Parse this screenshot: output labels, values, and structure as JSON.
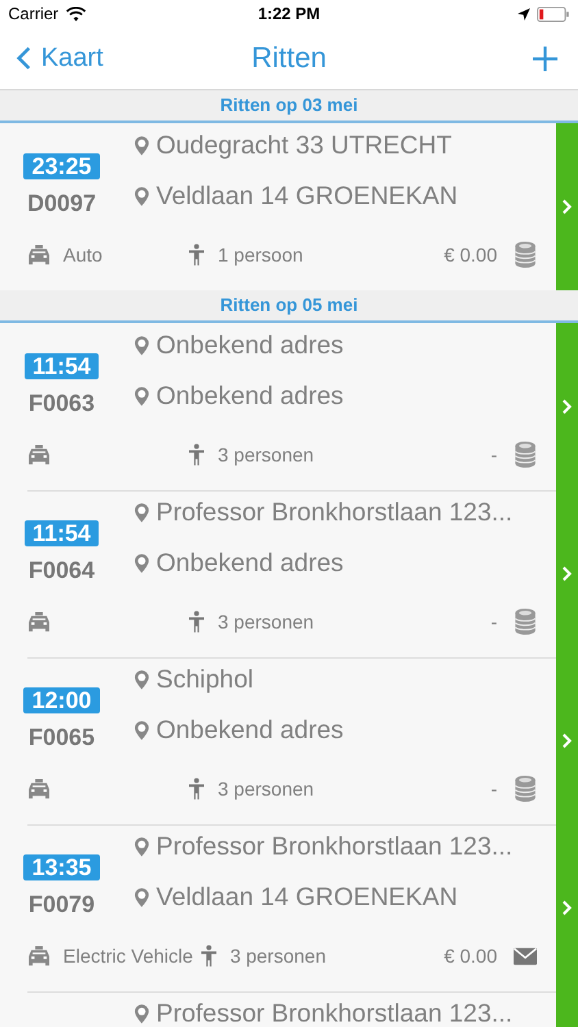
{
  "status_bar": {
    "carrier": "Carrier",
    "time": "1:22 PM"
  },
  "nav": {
    "back": "Kaart",
    "title": "Ritten"
  },
  "sections": [
    {
      "title": "Ritten op 03 mei",
      "rides": [
        {
          "time": "23:25",
          "id": "D0097",
          "from": "Oudegracht 33 UTRECHT",
          "to": "Veldlaan 14 GROENEKAN",
          "vehicle": "Auto",
          "passengers": "1 persoon",
          "price": "€ 0.00",
          "payment": {
            "kind": "coins"
          }
        }
      ]
    },
    {
      "title": "Ritten op 05 mei",
      "rides": [
        {
          "time": "11:54",
          "id": "F0063",
          "from": "Onbekend adres",
          "to": "Onbekend adres",
          "passengers": "3 personen",
          "price": "-",
          "payment": {
            "kind": "coins"
          }
        },
        {
          "time": "11:54",
          "id": "F0064",
          "from": "Professor Bronkhorstlaan 123...",
          "to": "Onbekend adres",
          "passengers": "3 personen",
          "price": "-",
          "payment": {
            "kind": "coins"
          }
        },
        {
          "time": "12:00",
          "id": "F0065",
          "from": "Schiphol",
          "to": "Onbekend adres",
          "passengers": "3 personen",
          "price": "-",
          "payment": {
            "kind": "coins"
          }
        },
        {
          "time": "13:35",
          "id": "F0079",
          "from": "Professor Bronkhorstlaan 123...",
          "to": "Veldlaan 14 GROENEKAN",
          "vehicle": "Electric Vehicle",
          "passengers": "3 personen",
          "price": "€ 0.00",
          "payment": {
            "kind": "mail"
          }
        },
        {
          "from": "Professor Bronkhorstlaan 123..."
        }
      ]
    }
  ]
}
